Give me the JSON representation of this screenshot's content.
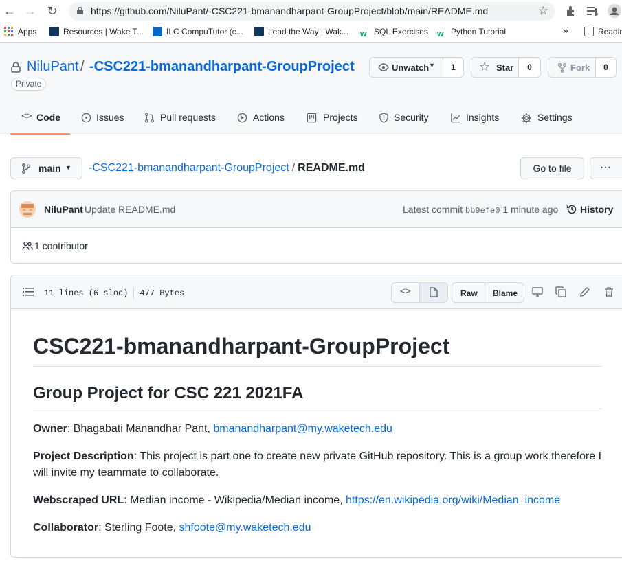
{
  "browser": {
    "url": "https://github.com/NiluPant/-CSC221-bmanandharpant-GroupProject/blob/main/README.md",
    "bookmarks": [
      {
        "label": "Apps"
      },
      {
        "label": "Resources | Wake T..."
      },
      {
        "label": "ILC CompuTutor (c..."
      },
      {
        "label": "Lead the Way | Wak..."
      },
      {
        "label": "SQL Exercises"
      },
      {
        "label": "Python Tutorial"
      },
      {
        "label": "Readin"
      }
    ],
    "overflow_label": "»"
  },
  "repo": {
    "owner": "NiluPant",
    "separator": "/",
    "name": "-CSC221-bmanandharpant-GroupProject",
    "visibility": "Private",
    "unwatch_label": "Unwatch",
    "watch_count": "1",
    "star_label": "Star",
    "star_count": "0",
    "fork_label": "Fork",
    "fork_count": "0"
  },
  "tabs": [
    {
      "label": "Code",
      "active": true
    },
    {
      "label": "Issues"
    },
    {
      "label": "Pull requests"
    },
    {
      "label": "Actions"
    },
    {
      "label": "Projects"
    },
    {
      "label": "Security"
    },
    {
      "label": "Insights"
    },
    {
      "label": "Settings"
    }
  ],
  "file_nav": {
    "branch": "main",
    "breadcrumb_repo": "-CSC221-bmanandharpant-GroupProject",
    "breadcrumb_sep": "/",
    "breadcrumb_file": "README.md",
    "goto_label": "Go to file",
    "more_label": "···"
  },
  "commit": {
    "author": "NiluPant",
    "message": "Update README.md",
    "latest_label": "Latest commit",
    "sha": "bb9efe0",
    "time": "1 minute ago",
    "history_label": "History",
    "contributors": "1 contributor"
  },
  "file": {
    "lines": "11 lines (6 sloc)",
    "size": "477 Bytes",
    "raw_label": "Raw",
    "blame_label": "Blame"
  },
  "readme": {
    "h1": "CSC221-bmanandharpant-GroupProject",
    "h2": "Group Project for CSC 221 2021FA",
    "owner_label": "Owner",
    "owner_text": ": Bhagabati Manandhar Pant, ",
    "owner_email": "bmanandharpant@my.waketech.edu",
    "desc_label": "Project Description",
    "desc_text": ": This project is part one to create new private GitHub repository. This is a group work therefore I will invite my teammate to collaborate.",
    "url_label": "Webscraped URL",
    "url_text": ": Median income - Wikipedia/Median income, ",
    "url_link": "https://en.wikipedia.org/wiki/Median_income",
    "collab_label": "Collaborator",
    "collab_text": ": Sterling Foote, ",
    "collab_email": "shfoote@my.waketech.edu"
  },
  "colors": {
    "link": "#0969da",
    "active_tab": "#fd8c73",
    "border": "#d0d7de"
  }
}
